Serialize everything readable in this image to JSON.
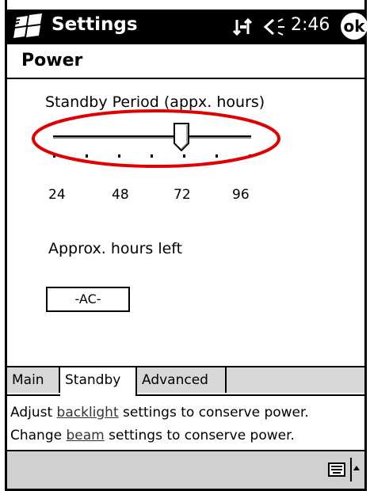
{
  "titlebar": {
    "title": "Settings",
    "clock": "2:46",
    "ok_label": "ok"
  },
  "page": {
    "heading": "Power"
  },
  "standby": {
    "slider_label": "Standby Period (appx. hours)",
    "ticks": [
      "24",
      "48",
      "72",
      "96"
    ],
    "value_hours": 72,
    "hours_left_label": "Approx. hours left",
    "power_source": "-AC-"
  },
  "tabs": [
    {
      "label": "Main",
      "active": false
    },
    {
      "label": "Standby",
      "active": true
    },
    {
      "label": "Advanced",
      "active": false
    }
  ],
  "help": {
    "line1": {
      "prefix": "Adjust ",
      "link": "backlight",
      "suffix": " settings to conserve power."
    },
    "line2": {
      "prefix": "Change ",
      "link": "beam",
      "suffix": " settings to conserve power."
    }
  },
  "colors": {
    "titlebar": "#000000",
    "highlight_oval": "#e00000",
    "tab_inactive": "#d8d8d8"
  }
}
